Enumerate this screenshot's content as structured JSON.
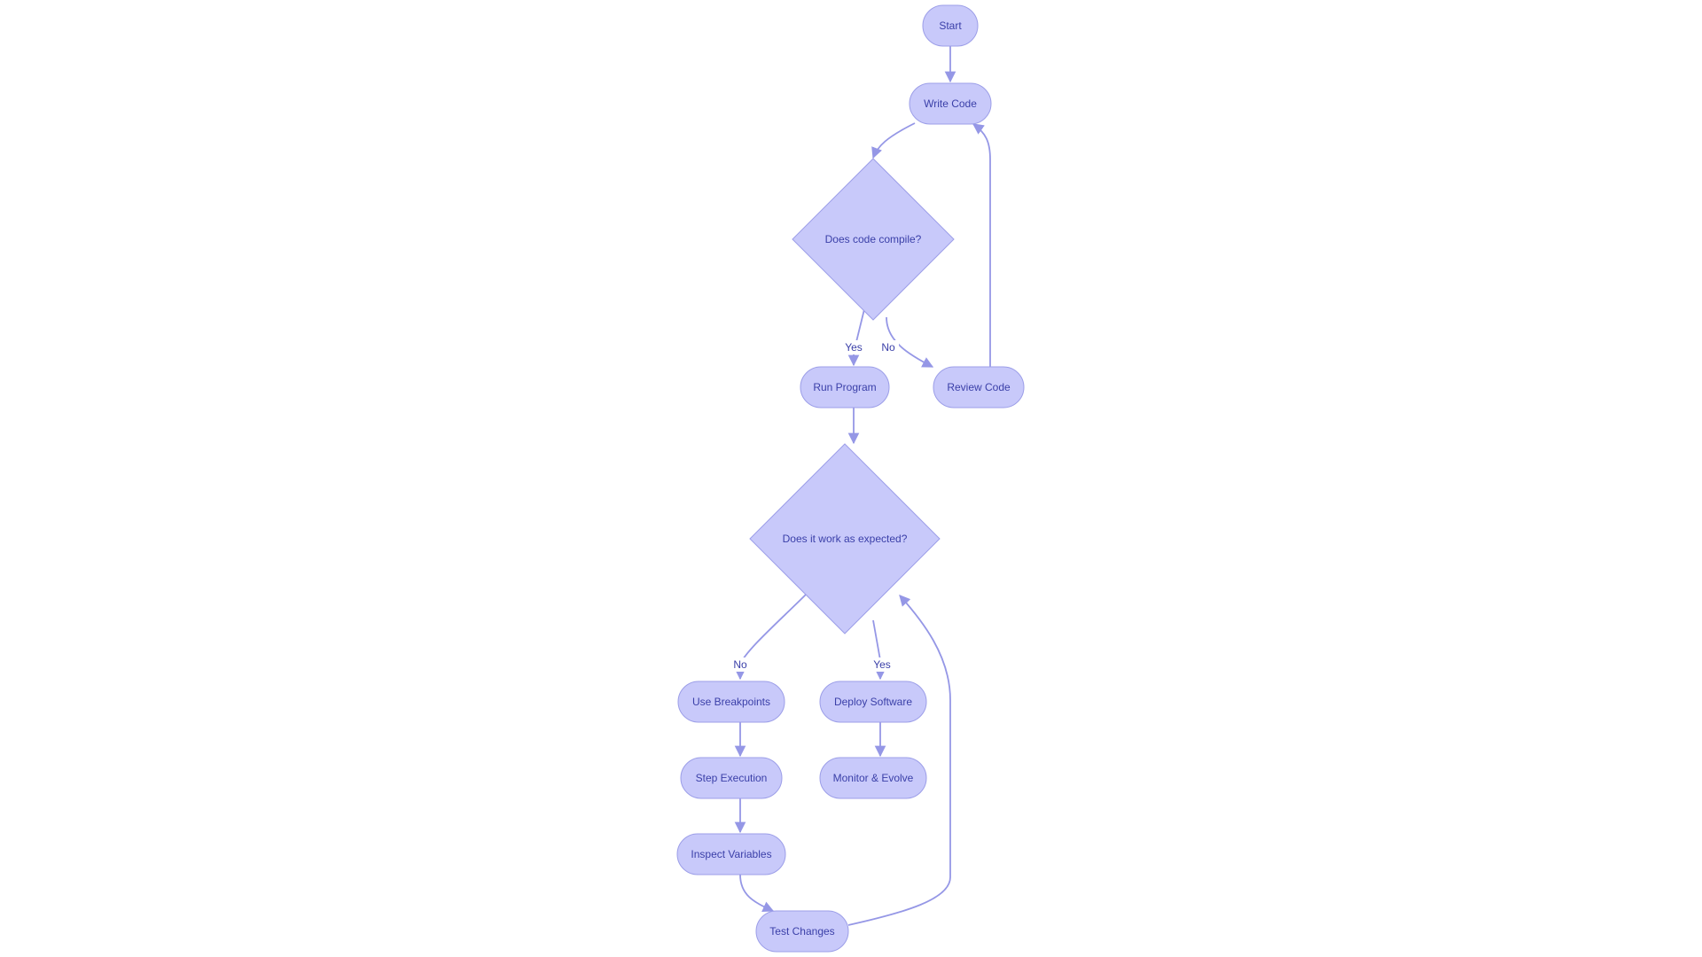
{
  "diagram": {
    "type": "flowchart",
    "direction": "top-down",
    "colors": {
      "node_fill": "#c8c9fa",
      "node_stroke": "#9c9ee8",
      "edge": "#9597e6",
      "text": "#3a3fa8"
    },
    "nodes": [
      {
        "id": "start",
        "label": "Start",
        "shape": "rounded"
      },
      {
        "id": "write_code",
        "label": "Write Code",
        "shape": "rounded"
      },
      {
        "id": "compile",
        "label": "Does code compile?",
        "shape": "diamond"
      },
      {
        "id": "run_program",
        "label": "Run Program",
        "shape": "rounded"
      },
      {
        "id": "review_code",
        "label": "Review Code",
        "shape": "rounded"
      },
      {
        "id": "works",
        "label": "Does it work as expected?",
        "shape": "diamond"
      },
      {
        "id": "use_breakpoints",
        "label": "Use Breakpoints",
        "shape": "rounded"
      },
      {
        "id": "deploy",
        "label": "Deploy Software",
        "shape": "rounded"
      },
      {
        "id": "step_exec",
        "label": "Step Execution",
        "shape": "rounded"
      },
      {
        "id": "monitor",
        "label": "Monitor & Evolve",
        "shape": "rounded"
      },
      {
        "id": "inspect_vars",
        "label": "Inspect Variables",
        "shape": "rounded"
      },
      {
        "id": "test_changes",
        "label": "Test Changes",
        "shape": "rounded"
      }
    ],
    "edges": [
      {
        "from": "start",
        "to": "write_code",
        "label": ""
      },
      {
        "from": "write_code",
        "to": "compile",
        "label": ""
      },
      {
        "from": "compile",
        "to": "run_program",
        "label": "Yes"
      },
      {
        "from": "compile",
        "to": "review_code",
        "label": "No"
      },
      {
        "from": "review_code",
        "to": "write_code",
        "label": ""
      },
      {
        "from": "run_program",
        "to": "works",
        "label": ""
      },
      {
        "from": "works",
        "to": "use_breakpoints",
        "label": "No"
      },
      {
        "from": "works",
        "to": "deploy",
        "label": "Yes"
      },
      {
        "from": "use_breakpoints",
        "to": "step_exec",
        "label": ""
      },
      {
        "from": "deploy",
        "to": "monitor",
        "label": ""
      },
      {
        "from": "step_exec",
        "to": "inspect_vars",
        "label": ""
      },
      {
        "from": "inspect_vars",
        "to": "test_changes",
        "label": ""
      },
      {
        "from": "test_changes",
        "to": "works",
        "label": ""
      }
    ]
  }
}
